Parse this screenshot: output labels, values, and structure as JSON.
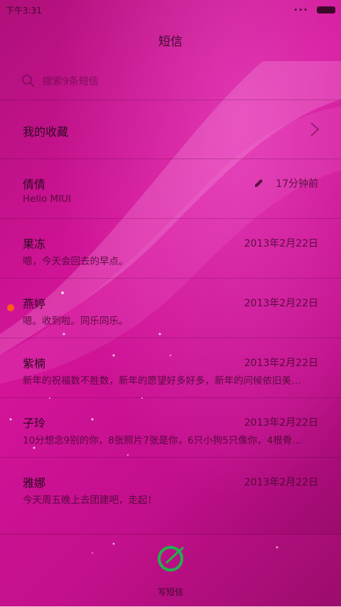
{
  "statusbar": {
    "time": "下午3:31",
    "dots": "•••"
  },
  "header": {
    "title": "短信"
  },
  "search": {
    "placeholder": "搜索9条短信"
  },
  "favorites": {
    "label": "我的收藏"
  },
  "threads": [
    {
      "name": "倩倩",
      "preview": "Hello MIUI",
      "time": "17分钟前",
      "draft": true,
      "unread": false
    },
    {
      "name": "果冻",
      "preview": "嗯，今天会回去的早点。",
      "time": "2013年2月22日",
      "draft": false,
      "unread": false
    },
    {
      "name": "燕婷",
      "preview": "嗯。收到啦。同乐同乐。",
      "time": "2013年2月22日",
      "draft": false,
      "unread": true
    },
    {
      "name": "紫楠",
      "preview": "新年的祝福数不胜数，新年的愿望好多好多，新年的问候依旧美…",
      "time": "2013年2月22日",
      "draft": false,
      "unread": false
    },
    {
      "name": "子玲",
      "preview": "10分想念9别的你，8张照片7张是你，6只小狗5只像你，4根骨…",
      "time": "2013年2月22日",
      "draft": false,
      "unread": false
    },
    {
      "name": "雅娜",
      "preview": "今天周五晚上去团建吧，走起！",
      "time": "2013年2月22日",
      "draft": false,
      "unread": false
    }
  ],
  "compose": {
    "label": "写短信"
  },
  "colors": {
    "accent": "#d4149a",
    "unread": "#ff5a1a",
    "compose_ring": "#22b14c"
  }
}
